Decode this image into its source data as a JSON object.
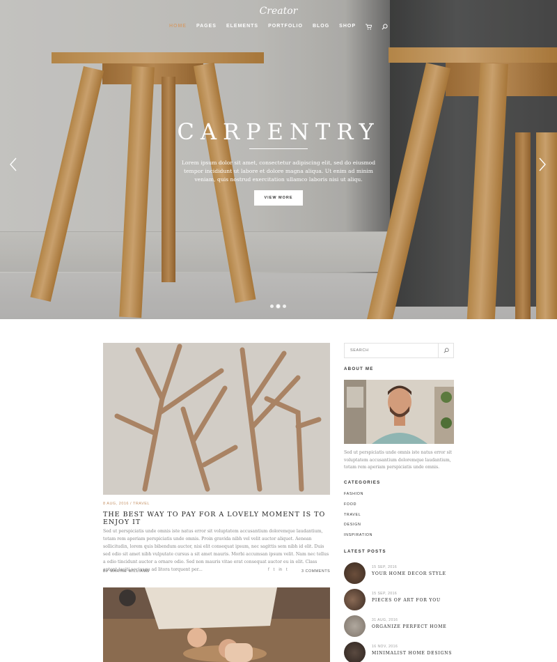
{
  "header": {
    "logo": "Creator",
    "nav": [
      {
        "label": "HOME",
        "active": true
      },
      {
        "label": "PAGES",
        "active": false
      },
      {
        "label": "ELEMENTS",
        "active": false
      },
      {
        "label": "PORTFOLIO",
        "active": false
      },
      {
        "label": "BLOG",
        "active": false
      },
      {
        "label": "SHOP",
        "active": false
      }
    ],
    "icons": [
      "cart-icon",
      "search-icon"
    ]
  },
  "slider": {
    "title": "CARPENTRY",
    "text": "Lorem ipsum dolor sit amet, consectetur adipiscing elit, sed do eiusmod tempor incididunt ut labore et dolore magna aliqua. Ut enim ad minim veniam, quis nostrud exercitation ullamco laboris nisi ut aliqu.",
    "button": "VIEW MORE",
    "slide_count": 3,
    "active_slide": 2
  },
  "post": {
    "meta": "8 AUG, 2016 / TRAVEL",
    "title": "THE BEST WAY TO PAY FOR A LOVELY MOMENT IS TO ENJOY IT",
    "excerpt": "Sed ut perspiciatis unde omnis iste natus error sit voluptatem accusantium doloremque laudantium, totam rem aperiam perspiciatis unde omnis. Proin gravida nibh vel velit auctor aliquet. Aenean sollicitudin, lorem quis bibendum auctor, nisi elit consequat ipsum, nec sagittis sem nibh id elit. Duis sed odio sit amet nibh vulputate cursus a sit amet mauris. Morbi accumsan ipsum velit. Nam nec tellus a odio tincidunt auctor a ornare odio. Sed non mauris vitae erat consequat auctor eu in elit. Class aptent taciti sociosqu ad litora torquent per...",
    "author": "BY MARINE WILLIAMS",
    "share": [
      "f",
      "t",
      "in",
      "t"
    ],
    "comments": "3 COMMENTS"
  },
  "sidebar": {
    "search_placeholder": "SEARCH",
    "about_heading": "ABOUT ME",
    "about_text": "Sed ut perspiciatis unde omnis iste natus error sit voluptatem accusantium doloremque laudantium, totam rem aperiam perspiciatis unde omnis.",
    "categories_heading": "CATEGORIES",
    "categories": [
      "FASHION",
      "FOOD",
      "TRAVEL",
      "DESIGN",
      "INSPIRATION"
    ],
    "latest_heading": "LATEST POSTS",
    "latest_posts": [
      {
        "date": "15 SEP, 2016",
        "title": "YOUR HOME DECOR STYLE"
      },
      {
        "date": "15 SEP, 2016",
        "title": "PIECES OF ART FOR YOU"
      },
      {
        "date": "31 AUG, 2016",
        "title": "ORGANIZE PERFECT HOME"
      },
      {
        "date": "16 NOV, 2016",
        "title": "MINIMALIST HOME DESIGNS"
      }
    ]
  },
  "colors": {
    "accent": "#c69469",
    "nav_active": "#d09f72",
    "text_dark": "#222222",
    "text_muted": "#888888"
  }
}
